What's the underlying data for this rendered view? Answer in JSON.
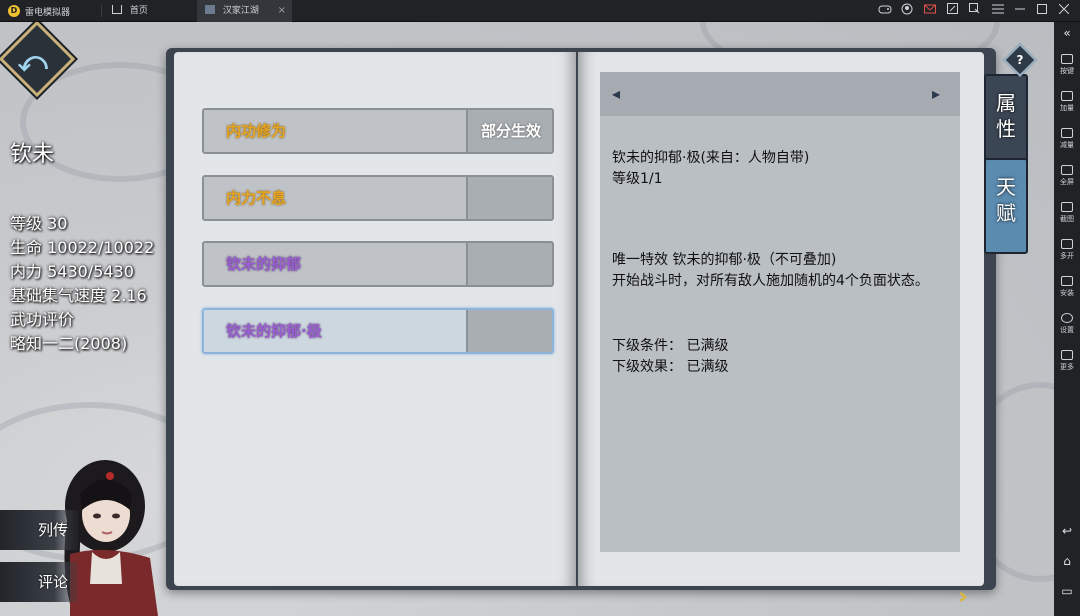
{
  "emulator": {
    "app_name": "雷电模拟器",
    "logo_letter": "D",
    "tabs": [
      {
        "label": "首页",
        "icon": "home-icon"
      },
      {
        "label": "汉家江湖",
        "icon": "game-icon"
      }
    ],
    "tab_close": "×",
    "window_controls": [
      "gamepad-icon",
      "account-icon",
      "mail-icon",
      "fullscreen-window-icon",
      "pin-icon",
      "menu-icon",
      "minimize-icon",
      "maximize-icon",
      "close-icon",
      "collapse-icon"
    ],
    "toolbar": [
      {
        "label": "按键",
        "icon": "keyboard-icon"
      },
      {
        "label": "加量",
        "icon": "volume-up-icon"
      },
      {
        "label": "减量",
        "icon": "volume-down-icon"
      },
      {
        "label": "全屏",
        "icon": "fullscreen-icon"
      },
      {
        "label": "截图",
        "icon": "scissors-icon"
      },
      {
        "label": "多开",
        "icon": "multi-instance-icon"
      },
      {
        "label": "安装",
        "icon": "apk-install-icon"
      },
      {
        "label": "设置",
        "icon": "settings-gear-icon"
      },
      {
        "label": "更多",
        "icon": "more-icon"
      }
    ],
    "nav_buttons": [
      "back-icon",
      "home-icon",
      "recent-apps-icon"
    ]
  },
  "character": {
    "name": "钦未",
    "stats": [
      "等级 30",
      "生命 10022/10022",
      "内力 5430/5430",
      "基础集气速度 2.16",
      "武功评价",
      "略知一二(2008)"
    ]
  },
  "side_buttons": {
    "biography": "列传",
    "comments": "评论"
  },
  "skills": [
    {
      "name": "内功修为",
      "status": "部分生效",
      "color": "gold",
      "selected": false
    },
    {
      "name": "内力不息",
      "status": "",
      "color": "gold",
      "selected": false
    },
    {
      "name": "钦未的抑郁",
      "status": "",
      "color": "purple",
      "selected": false
    },
    {
      "name": "钦未的抑郁·极",
      "status": "",
      "color": "purple",
      "selected": true
    }
  ],
  "detail": {
    "prev_arrow": "◂",
    "next_arrow_head": "▸",
    "title": "钦未的抑郁·极(来自：人物自带)",
    "level": "等级1/1",
    "effect_title": "唯一特效 钦未的抑郁·极（不可叠加)",
    "effect_desc": "开始战斗时，对所有敌人施加随机的4个负面状态。",
    "next_condition": "下级条件：  已满级",
    "next_effect": "下级效果：  已满级"
  },
  "page_next": "›",
  "help_label": "?",
  "book_tabs": {
    "attributes": "属性",
    "talent": "天赋"
  },
  "colors": {
    "gold": "#e8a520",
    "purple": "#9a5fd0",
    "selected_border": "#8fb4dc"
  }
}
